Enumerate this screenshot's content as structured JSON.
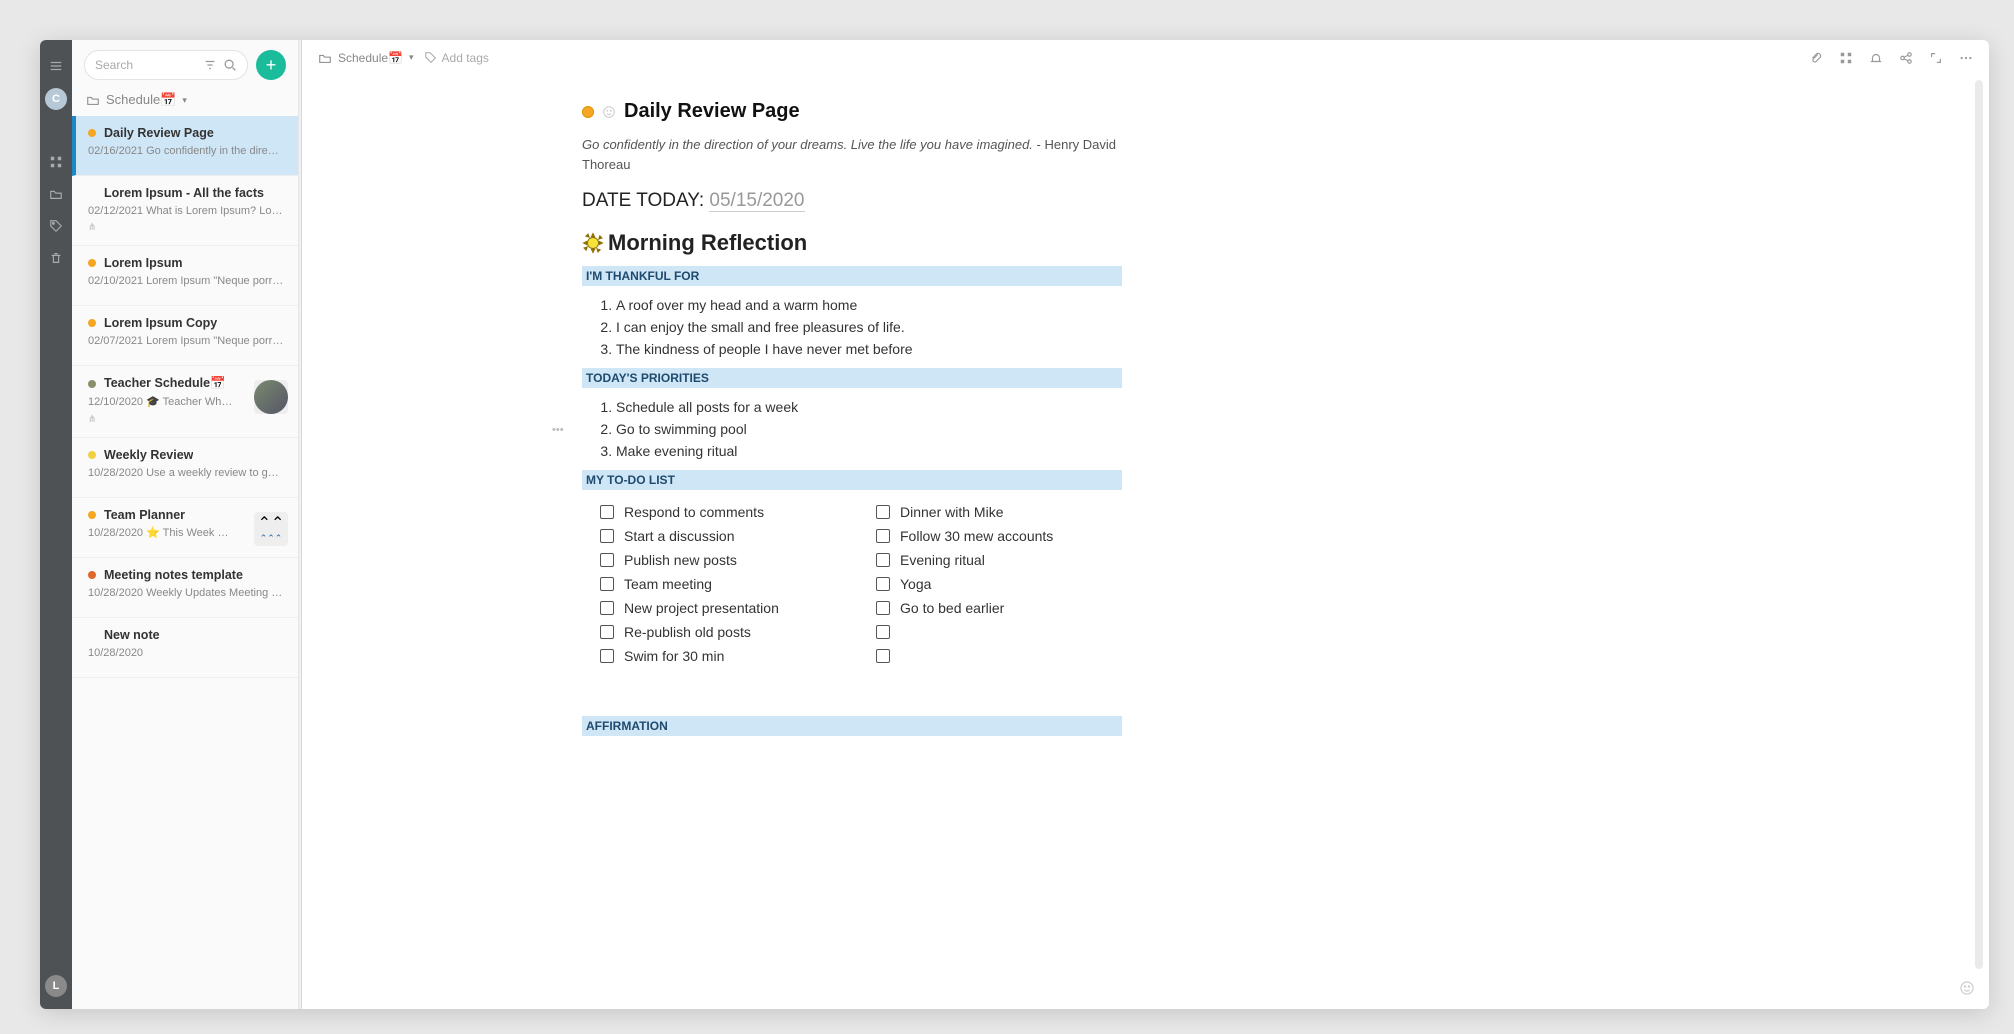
{
  "rail": {
    "avatar_letter": "C",
    "bottom_letter": "L"
  },
  "search": {
    "placeholder": "Search"
  },
  "notebook": {
    "name": "Schedule",
    "icon": "📅"
  },
  "notes": [
    {
      "title": "Daily Review Page",
      "date": "02/16/2021",
      "snippet": "Go confidently in the directio…",
      "dot": "#f5a623",
      "selected": true
    },
    {
      "title": "Lorem Ipsum - All the facts",
      "date": "02/12/2021",
      "snippet": "What is Lorem Ipsum? Lorem …",
      "dot": "transparent",
      "mini": true
    },
    {
      "title": "Lorem Ipsum",
      "date": "02/10/2021",
      "snippet": "Lorem Ipsum \"Neque porro q…",
      "dot": "#f5a623"
    },
    {
      "title": "Lorem Ipsum Copy",
      "date": "02/07/2021",
      "snippet": "Lorem Ipsum \"Neque porro q…",
      "dot": "#f5a623"
    },
    {
      "title": "Teacher Schedule📅",
      "date": "12/10/2020",
      "snippet": "🎓 Teacher Wh…",
      "dot": "#8a8f6a",
      "thumb": "avatar",
      "mini": true
    },
    {
      "title": "Weekly Review",
      "date": "10/28/2020",
      "snippet": "Use a weekly review to get rid…",
      "dot": "#f1d043"
    },
    {
      "title": "Team Planner",
      "date": "10/28/2020",
      "snippet": "⭐ This Week …",
      "dot": "#f5a623",
      "thumb": "arrows"
    },
    {
      "title": "Meeting notes template",
      "date": "10/28/2020",
      "snippet": "Weekly Updates Meeting Dat…",
      "dot": "#e0672c"
    },
    {
      "title": "New note",
      "date": "10/28/2020",
      "snippet": "",
      "dot": "transparent"
    }
  ],
  "breadcrumb": {
    "folder": "Schedule",
    "icon": "📅"
  },
  "tags": {
    "placeholder": "Add tags"
  },
  "doc": {
    "title": "Daily Review Page",
    "quote": "Go confidently in the direction of your dreams. Live the life you have imagined.",
    "quote_author": " - Henry David Thoreau",
    "date_label": "DATE TODAY: ",
    "date_value": "05/15/2020",
    "h2": "Morning Reflection",
    "sec1": "I'M THANKFUL FOR",
    "thankful": [
      "A roof over my head and a warm home",
      "I can enjoy the small and free pleasures of life.",
      "The kindness of people I have never met before"
    ],
    "sec2": "TODAY'S PRIORITIES",
    "priorities": [
      "Schedule all posts for a week",
      "Go to swimming pool",
      "Make evening ritual"
    ],
    "sec3": "MY TO-DO LIST",
    "todos_left": [
      "Respond to comments",
      "Start a discussion",
      "Publish new posts",
      "Team meeting",
      "New project presentation",
      "Re-publish old posts",
      "Swim for 30 min"
    ],
    "todos_right": [
      "Dinner with Mike",
      "Follow 30 mew accounts",
      "Evening ritual",
      "Yoga",
      "Go to bed earlier",
      "",
      ""
    ],
    "sec4": "AFFIRMATION"
  }
}
